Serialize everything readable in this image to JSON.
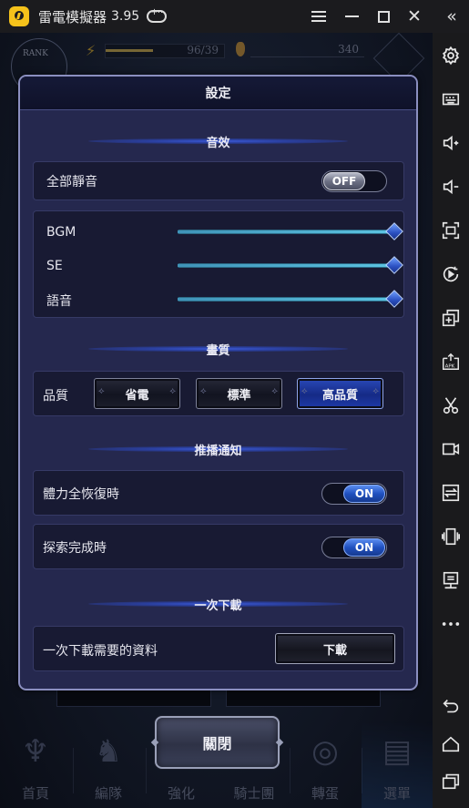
{
  "emulator": {
    "title": "雷電模擬器",
    "version": "3.95",
    "controls": {
      "menu_icon": "hamburger-menu-icon",
      "minimize_icon": "minimize-icon",
      "maximize_icon": "maximize-icon",
      "close_icon": "close-icon",
      "collapse_icon": "double-chevron-left-icon"
    },
    "close_glyph": "✕",
    "collapse_glyph": "«",
    "sidebar": [
      {
        "name": "settings",
        "icon": "gear-icon"
      },
      {
        "name": "keyboard-mapping",
        "icon": "keyboard-icon"
      },
      {
        "name": "volume-up",
        "icon": "volume-up-icon"
      },
      {
        "name": "volume-down",
        "icon": "volume-down-icon"
      },
      {
        "name": "fullscreen",
        "icon": "fullscreen-icon"
      },
      {
        "name": "record-operation",
        "icon": "record-play-icon"
      },
      {
        "name": "multi-instance",
        "icon": "add-window-icon"
      },
      {
        "name": "install-apk",
        "icon": "apk-install-icon"
      },
      {
        "name": "screenshot",
        "icon": "scissors-icon"
      },
      {
        "name": "video-record",
        "icon": "video-camera-icon"
      },
      {
        "name": "sync",
        "icon": "sync-arrows-icon"
      },
      {
        "name": "shake",
        "icon": "shake-phone-icon"
      },
      {
        "name": "virtual-display",
        "icon": "monitor-icon"
      },
      {
        "name": "more",
        "icon": "more-dots-icon"
      },
      {
        "name": "back",
        "icon": "back-arrow-icon"
      },
      {
        "name": "home",
        "icon": "home-icon"
      },
      {
        "name": "recent-apps",
        "icon": "recent-apps-icon"
      }
    ]
  },
  "game": {
    "hud": {
      "rank_label": "RANK",
      "stamina": "96/39",
      "stamina_fill": 0.4,
      "currency": "340"
    },
    "bottom_nav": [
      {
        "label": "首頁",
        "icon": "home-crest-icon",
        "glyph": "♆"
      },
      {
        "label": "編隊",
        "icon": "knight-helmet-icon",
        "glyph": "♞"
      },
      {
        "label": "強化",
        "icon": "enhance-icon",
        "glyph": "⚒"
      },
      {
        "label": "騎士團",
        "icon": "guild-icon",
        "glyph": "⚜"
      },
      {
        "label": "轉蛋",
        "icon": "gacha-globe-icon",
        "glyph": "◎"
      },
      {
        "label": "選單",
        "icon": "menu-scroll-icon",
        "glyph": "▤",
        "active": true
      }
    ],
    "close_button": "關閉"
  },
  "settings": {
    "title": "設定",
    "sections": {
      "sound": {
        "title": "音效",
        "mute_all": {
          "label": "全部靜音",
          "state": "OFF"
        },
        "sliders": [
          {
            "label": "BGM",
            "value": 1.0
          },
          {
            "label": "SE",
            "value": 1.0
          },
          {
            "label": "語音",
            "value": 1.0
          }
        ]
      },
      "graphics": {
        "title": "畫質",
        "quality_label": "品質",
        "options": [
          "省電",
          "標準",
          "高品質"
        ],
        "selected": "高品質"
      },
      "notifications": {
        "title": "推播通知",
        "items": [
          {
            "label": "體力全恢復時",
            "state": "ON"
          },
          {
            "label": "探索完成時",
            "state": "ON"
          }
        ]
      },
      "download": {
        "title": "一次下載",
        "label": "一次下載需要的資料",
        "button": "下載"
      }
    }
  }
}
